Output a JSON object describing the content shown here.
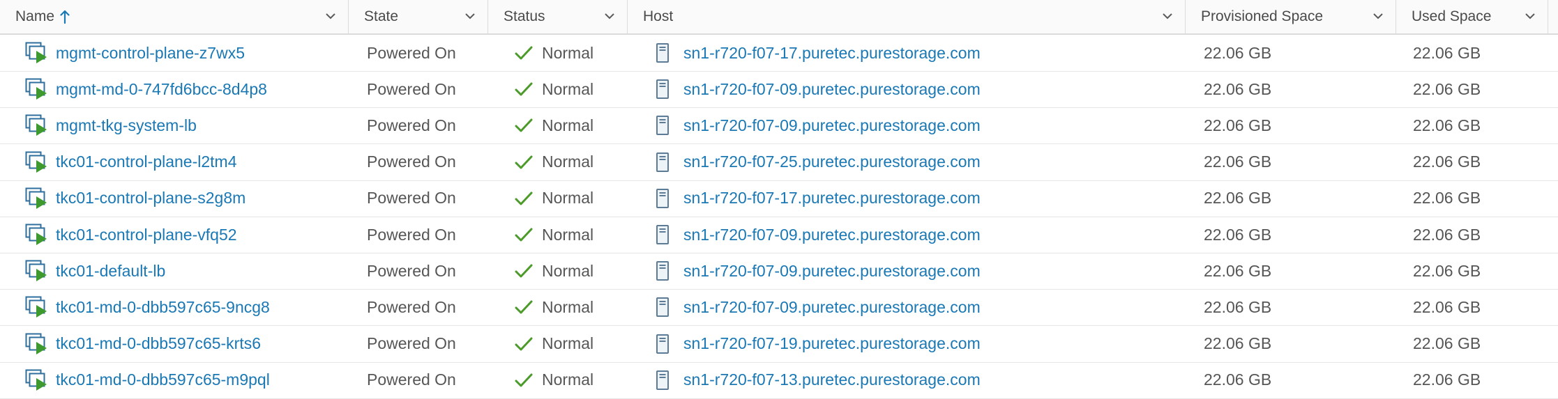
{
  "columns": [
    {
      "key": "name",
      "label": "Name"
    },
    {
      "key": "state",
      "label": "State"
    },
    {
      "key": "status",
      "label": "Status"
    },
    {
      "key": "host",
      "label": "Host"
    },
    {
      "key": "provisioned",
      "label": "Provisioned Space"
    },
    {
      "key": "used",
      "label": "Used Space"
    }
  ],
  "sort": {
    "column": "name",
    "direction": "ascending"
  },
  "icons": {
    "vm": "vm-powered-on-icon",
    "status": "check-icon",
    "host": "host-icon",
    "sort": "sort-ascending-icon",
    "column_menu": "chevron-down-icon"
  },
  "colors": {
    "link": "#1a78b4",
    "ok": "#4c9a2a",
    "vm_play": "#3e9a2e",
    "vm_frame": "#2e6f9e"
  },
  "rows": [
    {
      "name": "mgmt-control-plane-z7wx5",
      "state": "Powered On",
      "status": "Normal",
      "host": "sn1-r720-f07-17.puretec.purestorage.com",
      "provisioned": "22.06 GB",
      "used": "22.06 GB"
    },
    {
      "name": "mgmt-md-0-747fd6bcc-8d4p8",
      "state": "Powered On",
      "status": "Normal",
      "host": "sn1-r720-f07-09.puretec.purestorage.com",
      "provisioned": "22.06 GB",
      "used": "22.06 GB"
    },
    {
      "name": "mgmt-tkg-system-lb",
      "state": "Powered On",
      "status": "Normal",
      "host": "sn1-r720-f07-09.puretec.purestorage.com",
      "provisioned": "22.06 GB",
      "used": "22.06 GB"
    },
    {
      "name": "tkc01-control-plane-l2tm4",
      "state": "Powered On",
      "status": "Normal",
      "host": "sn1-r720-f07-25.puretec.purestorage.com",
      "provisioned": "22.06 GB",
      "used": "22.06 GB"
    },
    {
      "name": "tkc01-control-plane-s2g8m",
      "state": "Powered On",
      "status": "Normal",
      "host": "sn1-r720-f07-17.puretec.purestorage.com",
      "provisioned": "22.06 GB",
      "used": "22.06 GB"
    },
    {
      "name": "tkc01-control-plane-vfq52",
      "state": "Powered On",
      "status": "Normal",
      "host": "sn1-r720-f07-09.puretec.purestorage.com",
      "provisioned": "22.06 GB",
      "used": "22.06 GB"
    },
    {
      "name": "tkc01-default-lb",
      "state": "Powered On",
      "status": "Normal",
      "host": "sn1-r720-f07-09.puretec.purestorage.com",
      "provisioned": "22.06 GB",
      "used": "22.06 GB"
    },
    {
      "name": "tkc01-md-0-dbb597c65-9ncg8",
      "state": "Powered On",
      "status": "Normal",
      "host": "sn1-r720-f07-09.puretec.purestorage.com",
      "provisioned": "22.06 GB",
      "used": "22.06 GB"
    },
    {
      "name": "tkc01-md-0-dbb597c65-krts6",
      "state": "Powered On",
      "status": "Normal",
      "host": "sn1-r720-f07-19.puretec.purestorage.com",
      "provisioned": "22.06 GB",
      "used": "22.06 GB"
    },
    {
      "name": "tkc01-md-0-dbb597c65-m9pql",
      "state": "Powered On",
      "status": "Normal",
      "host": "sn1-r720-f07-13.puretec.purestorage.com",
      "provisioned": "22.06 GB",
      "used": "22.06 GB"
    }
  ]
}
